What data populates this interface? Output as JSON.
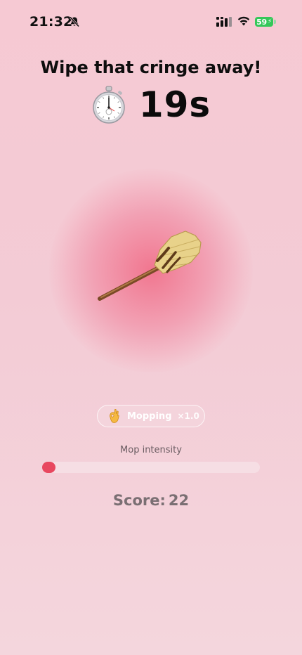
{
  "status_bar": {
    "time": "21:32",
    "battery": "59"
  },
  "header": {
    "title": "Wipe that cringe away!",
    "timer": "19s"
  },
  "game": {
    "tool_icon": "broom-icon",
    "mode_icon": "ok-hand-icon",
    "mode_label": "Mopping",
    "multiplier": "×1.0"
  },
  "intensity": {
    "label": "Mop intensity",
    "value_fraction": 0.06,
    "color": "#e8475f"
  },
  "score": {
    "label": "Score:",
    "value": "22"
  }
}
